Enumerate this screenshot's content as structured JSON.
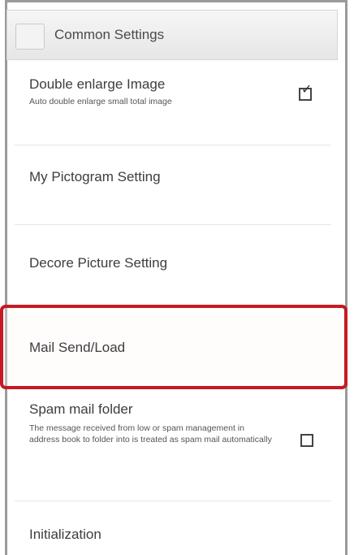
{
  "header": {
    "title": "Common Settings"
  },
  "items": [
    {
      "title": "Double enlarge Image",
      "subtitle": "Auto double enlarge small total image",
      "checked": true
    },
    {
      "title": "My Pictogram Setting"
    },
    {
      "title": "Decore Picture Setting"
    },
    {
      "title": "Mail Send/Load"
    },
    {
      "title": "Spam mail folder",
      "subtitle": "The message received from low or spam management in address book to folder into is treated as spam mail automatically",
      "checked": false
    },
    {
      "title": "Initialization"
    }
  ],
  "colors": {
    "highlight": "#c51a24",
    "header_bg": "#ececec"
  }
}
